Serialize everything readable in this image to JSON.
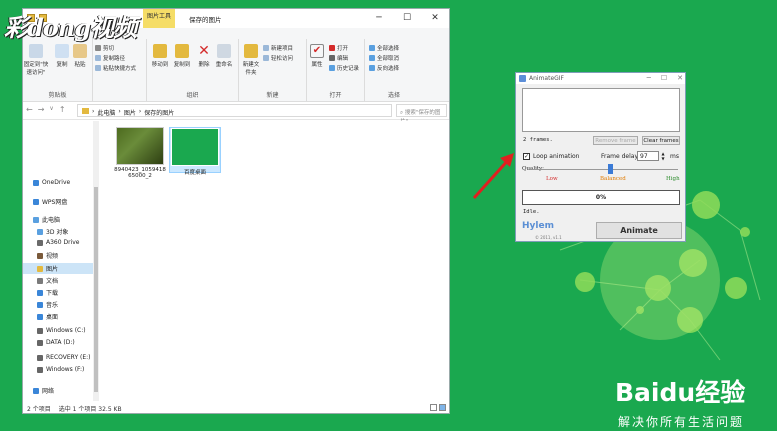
{
  "watermark": {
    "text": "彩dong视频"
  },
  "explorer": {
    "context_tab": "图片工具",
    "context_sub": "管理",
    "window_title": "保存的图片",
    "ribbon_groups": [
      {
        "name": "剪贴板"
      },
      {
        "name": "组织"
      },
      {
        "name": "新建"
      },
      {
        "name": "打开"
      },
      {
        "name": "选择"
      }
    ],
    "clipboard": {
      "pin": "固定到\"快速访问\"",
      "copy": "复制",
      "paste": "粘贴",
      "cut": "剪切",
      "copy_path": "复制路径",
      "paste_shortcut": "粘贴快捷方式"
    },
    "organize": {
      "move_to": "移动到",
      "copy_to": "复制到",
      "delete": "删除",
      "rename": "重命名"
    },
    "new": {
      "new_folder": "新建文件夹",
      "new_item": "新建项目",
      "easy_access": "轻松访问"
    },
    "open": {
      "properties": "属性",
      "open": "打开",
      "edit": "编辑",
      "history": "历史记录"
    },
    "select": {
      "select_all": "全部选择",
      "select_none": "全部取消",
      "invert": "反向选择"
    },
    "address": {
      "parts": [
        "此电脑",
        "图片",
        "保存的图片"
      ]
    },
    "search_placeholder": "搜索\"保存的图片\"",
    "sidebar": [
      {
        "label": "OneDrive",
        "color": "#3a86d8"
      },
      {
        "label": "WPS网盘",
        "color": "#3a86d8"
      },
      {
        "label": "此电脑",
        "color": "#5aa0e0"
      },
      {
        "label": "3D 对象",
        "color": "#5aa0e0"
      },
      {
        "label": "A360 Drive",
        "color": "#6a6a6a"
      },
      {
        "label": "视频",
        "color": "#7a5a3a"
      },
      {
        "label": "图片",
        "color": "#e3b93f",
        "selected": true
      },
      {
        "label": "文档",
        "color": "#7a7a7a"
      },
      {
        "label": "下载",
        "color": "#3a86d8"
      },
      {
        "label": "音乐",
        "color": "#3a86d8"
      },
      {
        "label": "桌面",
        "color": "#3a86d8"
      },
      {
        "label": "Windows (C:)",
        "color": "#666"
      },
      {
        "label": "DATA (D:)",
        "color": "#666"
      },
      {
        "label": "RECOVERY (E:)",
        "color": "#666"
      },
      {
        "label": "Windows (F:)",
        "color": "#666"
      },
      {
        "label": "网络",
        "color": "#3a86d8"
      }
    ],
    "files": [
      {
        "name": "8940423_105941865000_2",
        "selected": false
      },
      {
        "name": "百度桌面",
        "selected": true
      }
    ],
    "status": {
      "count": "2 个项目",
      "selection": "选中 1 个项目  32.5 KB"
    }
  },
  "gif_dialog": {
    "title": "AnimateGIF",
    "frames": "2 frames.",
    "remove_frame": "Remove frame",
    "clear_frames": "Clear frames",
    "loop_label": "Loop animation",
    "loop_checked": true,
    "frame_delay_label": "Frame delay:",
    "frame_delay_value": "97",
    "ms": "ms",
    "quality_label": "Quality:",
    "quality_low": "Low",
    "quality_balanced": "Balanced",
    "quality_high": "High",
    "progress": "0%",
    "status": "Idle.",
    "logo": "Hylem",
    "copyright": "© 2011, v1.1",
    "animate_button": "Animate"
  },
  "baidu": {
    "logo": "Baidu经验",
    "slogan": "解决你所有生活问题"
  }
}
